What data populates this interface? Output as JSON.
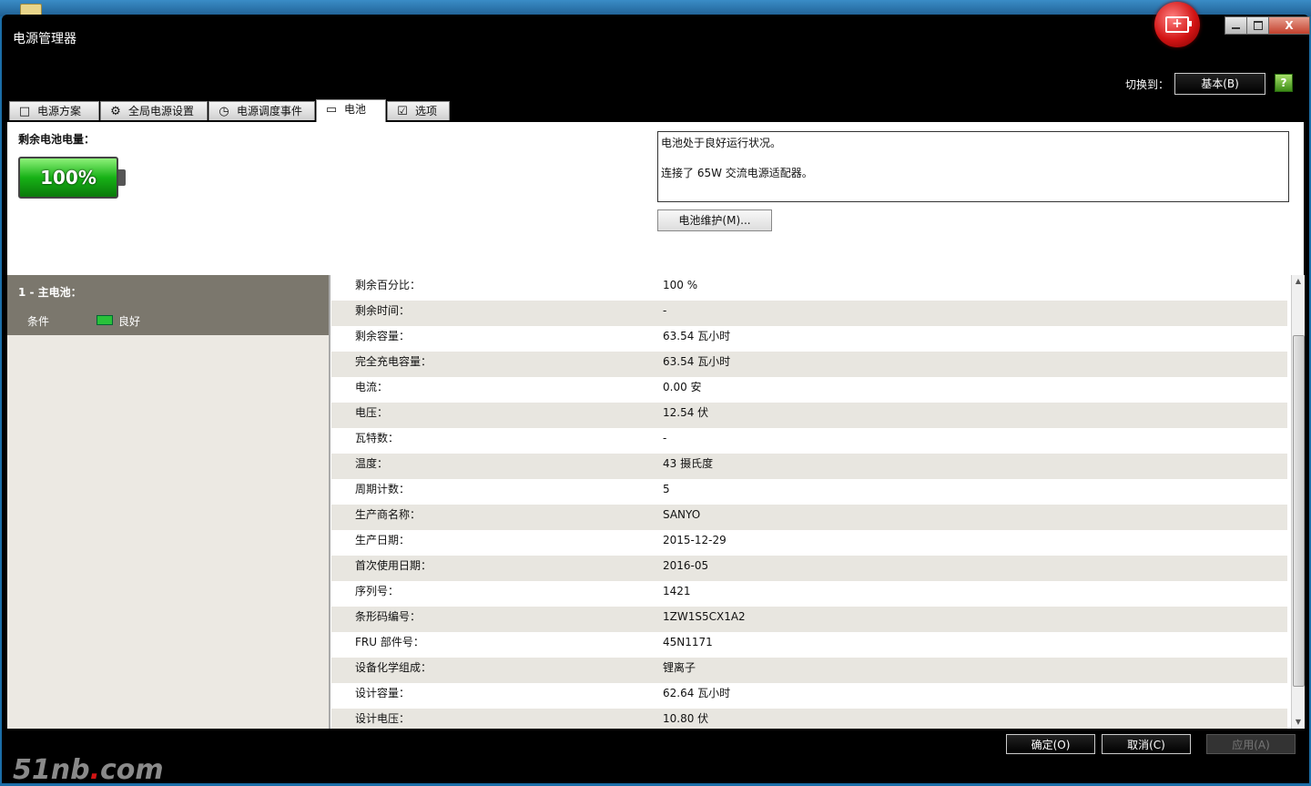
{
  "window": {
    "title": "电源管理器",
    "close_label": "X"
  },
  "header": {
    "switch_label": "切换到：",
    "switch_button": "基本(B)",
    "help_icon": "?"
  },
  "tabs": [
    {
      "label": "电源方案",
      "icon": "□"
    },
    {
      "label": "全局电源设置",
      "icon": "⚙"
    },
    {
      "label": "电源调度事件",
      "icon": "◷"
    },
    {
      "label": "电池",
      "icon": "▭"
    },
    {
      "label": "选项",
      "icon": "☑"
    }
  ],
  "battery": {
    "remaining_label": "剩余电池电量：",
    "percent_display": "100%",
    "status_line1": "电池处于良好运行状况。",
    "status_line2": "连接了 65W 交流电源适配器。",
    "maintenance_button": "电池维护(M)..."
  },
  "sidebar": {
    "title": "1 - 主电池：",
    "condition_label": "条件",
    "condition_value": "良好"
  },
  "details": [
    {
      "key": "剩余百分比：",
      "value": "100 %"
    },
    {
      "key": "剩余时间：",
      "value": "-"
    },
    {
      "key": "剩余容量：",
      "value": "63.54 瓦小时"
    },
    {
      "key": "完全充电容量：",
      "value": "63.54 瓦小时"
    },
    {
      "key": "电流：",
      "value": "0.00 安"
    },
    {
      "key": "电压：",
      "value": "12.54 伏"
    },
    {
      "key": "瓦特数：",
      "value": "-"
    },
    {
      "key": "温度：",
      "value": "43 摄氏度"
    },
    {
      "key": "周期计数：",
      "value": "5"
    },
    {
      "key": "生产商名称：",
      "value": "SANYO"
    },
    {
      "key": "生产日期：",
      "value": "2015-12-29"
    },
    {
      "key": "首次使用日期：",
      "value": "2016-05"
    },
    {
      "key": "序列号：",
      "value": "1421"
    },
    {
      "key": "条形码编号：",
      "value": "1ZW1S5CX1A2"
    },
    {
      "key": "FRU 部件号：",
      "value": "45N1171"
    },
    {
      "key": "设备化学组成：",
      "value": "锂离子"
    },
    {
      "key": "设计容量：",
      "value": "62.64 瓦小时"
    },
    {
      "key": "设计电压：",
      "value": "10.80 伏"
    }
  ],
  "footer": {
    "ok": "确定(O)",
    "cancel": "取消(C)",
    "apply": "应用(A)"
  },
  "watermark": {
    "part1": "51nb",
    "dot": ".",
    "part2": "com"
  }
}
